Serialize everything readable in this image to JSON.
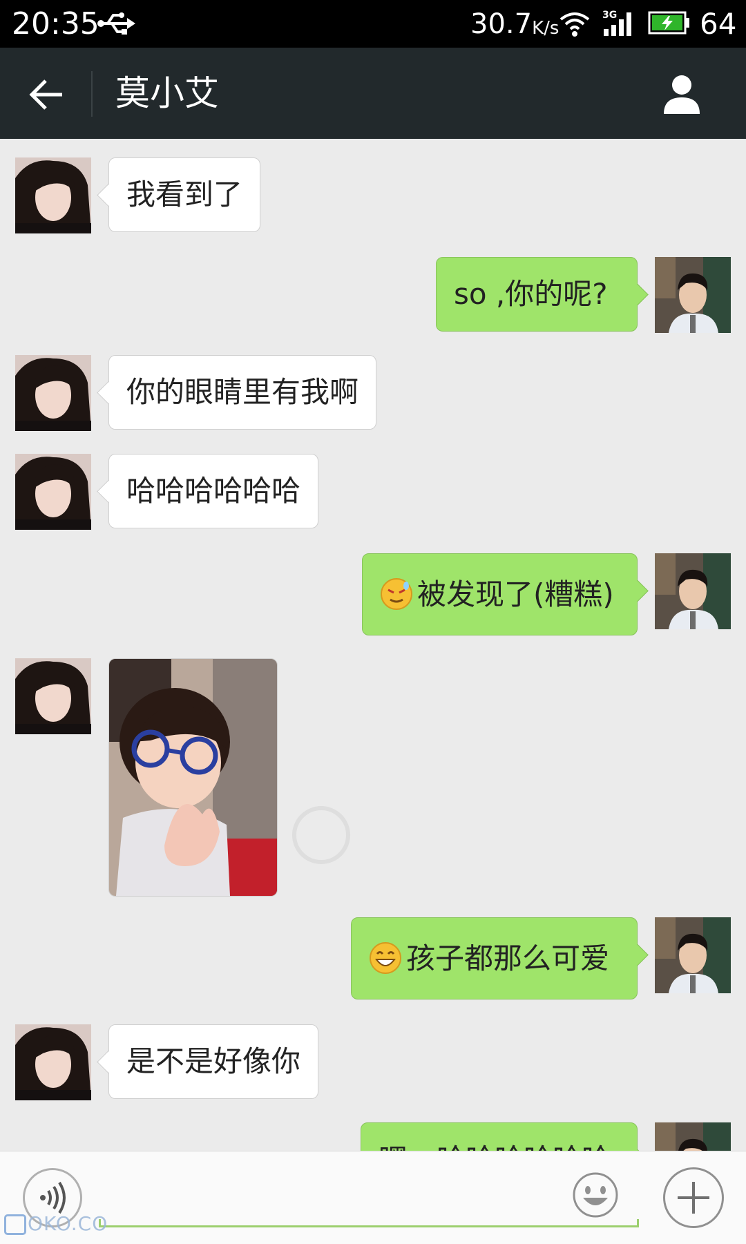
{
  "status_bar": {
    "time": "20:35",
    "net_speed": "30.7",
    "net_speed_unit": "K/s",
    "network_type": "3G",
    "battery_level": "64"
  },
  "header": {
    "title": "莫小艾"
  },
  "messages": [
    {
      "side": "in",
      "type": "text",
      "text": "我看到了"
    },
    {
      "side": "out",
      "type": "text",
      "text": "so ,你的呢?"
    },
    {
      "side": "in",
      "type": "text",
      "text": "你的眼睛里有我啊"
    },
    {
      "side": "in",
      "type": "text",
      "text": "哈哈哈哈哈哈"
    },
    {
      "side": "out",
      "type": "text",
      "emoji": "sweat-smile-emoji",
      "text": "被发现了(糟糕)"
    },
    {
      "side": "in",
      "type": "image",
      "image": "child-photo"
    },
    {
      "side": "out",
      "type": "text",
      "emoji": "grin-emoji",
      "text": "孩子都那么可爱"
    },
    {
      "side": "in",
      "type": "text",
      "text": "是不是好像你"
    },
    {
      "side": "out",
      "type": "text",
      "text": "嘿，哈哈哈哈哈哈"
    }
  ],
  "input_bar": {
    "placeholder": "",
    "value": ""
  },
  "watermark": "OKO.CO",
  "colors": {
    "outgoing_bubble": "#9fe46a",
    "incoming_bubble": "#ffffff",
    "header_bg": "#22292c",
    "chat_bg": "#ebebeb"
  }
}
